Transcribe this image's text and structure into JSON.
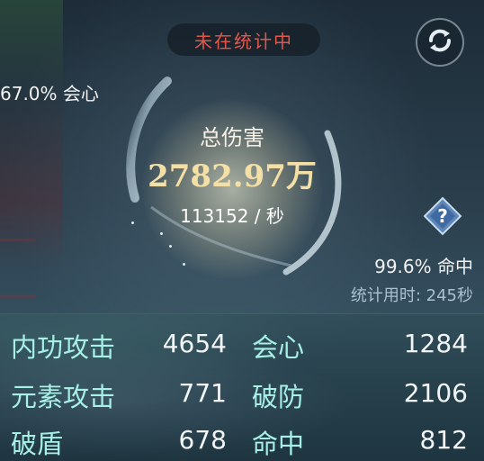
{
  "status": {
    "label": "未在统计中",
    "color": "#e2574c"
  },
  "icons": {
    "refresh": "refresh-icon",
    "help": "question-diamond-icon"
  },
  "damage": {
    "label": "总伤害",
    "total": "2782.97万",
    "per_second": "113152 / 秒"
  },
  "crit_rate": "67.0% 会心",
  "hit_rate": "99.6% 命中",
  "stat_time": "统计用时: 245秒",
  "stats": [
    {
      "left_label": "内功攻击",
      "left_value": "4654",
      "right_label": "会心",
      "right_value": "1284"
    },
    {
      "left_label": "元素攻击",
      "left_value": "771",
      "right_label": "破防",
      "right_value": "2106"
    },
    {
      "left_label": "破盾",
      "left_value": "678",
      "right_label": "命中",
      "right_value": "812"
    }
  ],
  "colors": {
    "accent_gold": "#f4dfa6",
    "stat_label": "#a7f0e6",
    "status_red": "#e2574c"
  }
}
